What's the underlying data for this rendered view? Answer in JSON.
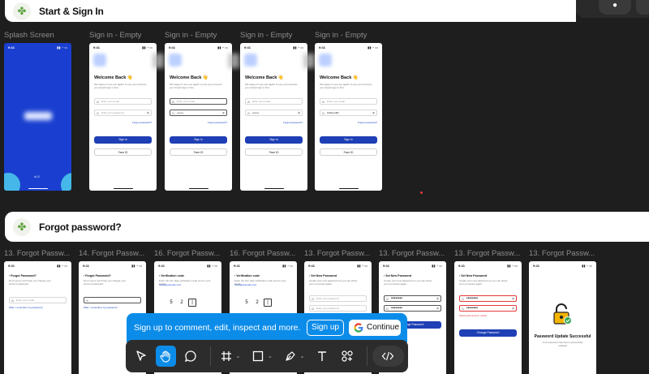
{
  "sections": {
    "start": {
      "title": "Start & Sign In"
    },
    "forgot": {
      "title": "Forgot password?"
    }
  },
  "row1": {
    "labels": [
      "Splash Screen",
      "Sign in - Empty",
      "Sign in - Empty",
      "Sign in - Empty",
      "Sign in - Empty"
    ],
    "splash": {
      "time": "9:41",
      "footer": "v1.0"
    },
    "signin": {
      "time": "9:41",
      "welcome": "Welcome Back 👋",
      "subtitle": "We happy to see you again! to use your account, you should sign in first.",
      "email_placeholder": "Enter your email",
      "password_placeholder": "Enter your password",
      "password_masked": "••••••••",
      "password_shown": "123Lomi01",
      "forgot": "Forgot password?",
      "sign_in": "Sign In",
      "face_id": "Face ID"
    }
  },
  "row2": {
    "labels": [
      "13. Forgot Passw...",
      "14. Forgot Passw...",
      "16. Forgot Passw...",
      "16. Forgot Passw...",
      "13. Forgot Passw...",
      "13. Forgot Passw...",
      "13. Forgot Passw...",
      "13. Forgot Passw..."
    ],
    "time": "9:41",
    "forgot_title": "Forgot Password?",
    "forgot_sub": "Don't worry! we'll help you change your account password",
    "email_placeholder": "Enter your email",
    "remember": "Wait, I remember my password",
    "verif_title": "Verification code",
    "verif_sub": "Enter the four digit verification code sent to your email",
    "verif_email": "hello@example.com",
    "digits_a": [
      "5",
      "2",
      "|",
      ""
    ],
    "digits_b": [
      "5",
      "2",
      "|",
      ""
    ],
    "newpass_title": "Set New Password",
    "newpass_sub": "Create your new password so you can share your memories again",
    "newpass_placeholder": "Enter your password",
    "masked": "••••••••",
    "change_btn": "Change Password",
    "error_text": "Passwords doesn't match",
    "success_title": "Password Update Successful",
    "success_sub": "Your password has been successfully updated"
  },
  "banner": {
    "message": "Sign up to comment, edit, inspect and more.",
    "sign_up": "Sign up",
    "continue": "Continue"
  },
  "toolbar": {
    "tools": [
      "move-icon",
      "hand-icon",
      "comment-icon",
      "frame-icon",
      "rectangle-icon",
      "pen-icon",
      "text-icon",
      "components-icon",
      "dev-mode-icon"
    ]
  },
  "colors": {
    "accent": "#0c8ce9",
    "canvas": "#1e1e1e",
    "primary_button": "#1e3fb5"
  }
}
